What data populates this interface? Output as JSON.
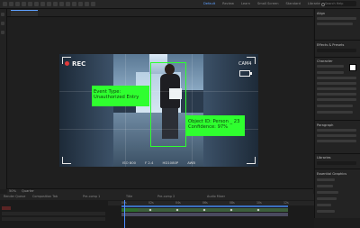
{
  "top_bar": {
    "comp_tab_label": "Composition",
    "workspaces": [
      "Default",
      "Review",
      "Learn",
      "Small Screen",
      "Standard",
      "Libraries"
    ],
    "active_workspace_index": 0,
    "search_placeholder": "Search Help"
  },
  "overlay": {
    "rec_label": "REC",
    "cam_label": "CAM4",
    "event_label": "Event Type:\nUnauthorized Entry",
    "object_label": "Object ID: Person _ 23\nConfidence: 97%",
    "bottom_readouts": [
      "ISO 800",
      "F 2.4",
      "HD1080P",
      "AWB"
    ]
  },
  "viewer_footer": {
    "zoom": "50%",
    "resolution": "Quarter"
  },
  "right_panel": {
    "sections": [
      "Align",
      "Effects & Presets",
      "Character",
      "Paragraph",
      "Libraries",
      "Essential Graphics"
    ],
    "effects_search_placeholder": "Search"
  },
  "timeline": {
    "tabs": [
      "Render Queue",
      "Composition Tab",
      "Pre-comp 1",
      "Title",
      "Pre-comp 2",
      "Audio Mixer"
    ],
    "ruler_ticks": [
      "00s",
      "02s",
      "04s",
      "06s",
      "08s",
      "10s",
      "12s"
    ]
  },
  "colors": {
    "accent": "#4c8dff",
    "detection_green": "#2fff2f",
    "rec_red": "#e03a3a"
  }
}
